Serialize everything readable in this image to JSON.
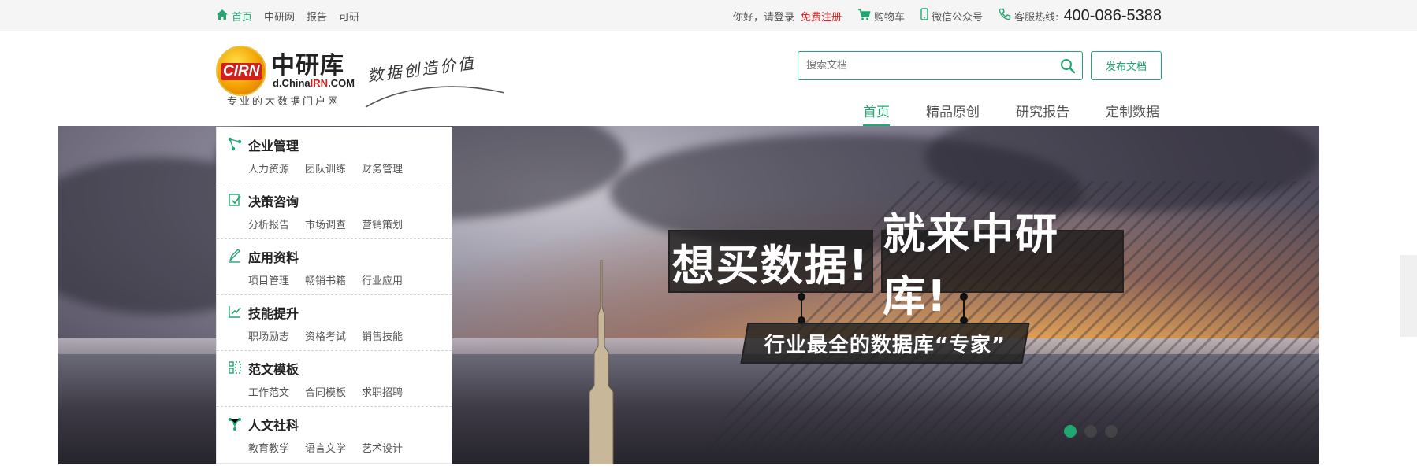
{
  "topbar": {
    "nav": [
      {
        "label": "首页",
        "active": true
      },
      {
        "label": "中研网",
        "active": false
      },
      {
        "label": "报告",
        "active": false
      },
      {
        "label": "可研",
        "active": false
      }
    ],
    "greeting": "你好，请登录",
    "register": "免费注册",
    "cart": "购物车",
    "wechat": "微信公众号",
    "hotline_label": "客服热线:",
    "hotline": "400-086-5388"
  },
  "header": {
    "logo_badge": "CIRN",
    "logo_name": "中研库",
    "logo_domain_pre": "d.China",
    "logo_domain_mid": "IRN",
    "logo_domain_post": ".COM",
    "logo_tagline": "专业的大数据门户网",
    "slogan": "数据创造价值",
    "search_placeholder": "搜索文档",
    "publish": "发布文档",
    "tabs": [
      {
        "label": "首页",
        "active": true
      },
      {
        "label": "精品原创",
        "active": false
      },
      {
        "label": "研究报告",
        "active": false
      },
      {
        "label": "定制数据",
        "active": false
      }
    ]
  },
  "categories": [
    {
      "title": "企业管理",
      "icon": "network-icon",
      "subs": [
        "人力资源",
        "团队训练",
        "财务管理"
      ]
    },
    {
      "title": "决策咨询",
      "icon": "document-check-icon",
      "subs": [
        "分析报告",
        "市场调查",
        "营销策划"
      ]
    },
    {
      "title": "应用资料",
      "icon": "pen-icon",
      "subs": [
        "项目管理",
        "畅销书籍",
        "行业应用"
      ]
    },
    {
      "title": "技能提升",
      "icon": "chart-growth-icon",
      "subs": [
        "职场励志",
        "资格考试",
        "销售技能"
      ]
    },
    {
      "title": "范文模板",
      "icon": "template-icon",
      "subs": [
        "工作范文",
        "合同模板",
        "求职招聘"
      ]
    },
    {
      "title": "人文社科",
      "icon": "share-icon",
      "subs": [
        "教育教学",
        "语言文学",
        "艺术设计"
      ]
    }
  ],
  "banner": {
    "headline_1": "想买数据!",
    "headline_2": "就来中研库!",
    "subline": "行业最全的数据库“专家”",
    "slides": 3,
    "active_slide": 1
  },
  "colors": {
    "accent": "#21a770",
    "register": "#e02020"
  }
}
